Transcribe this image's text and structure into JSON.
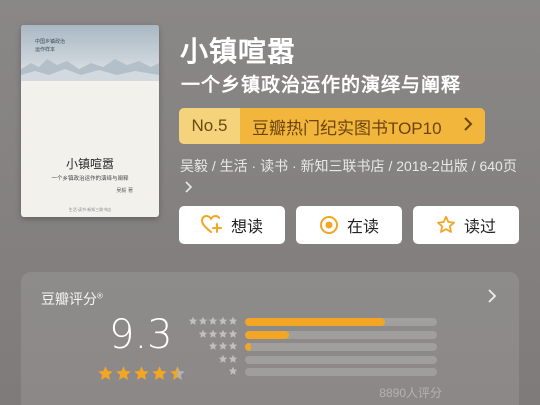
{
  "cover": {
    "series_line1": "中国乡镇政治",
    "series_line2": "运作样本",
    "title": "小镇喧嚣",
    "subtitle": "一个乡镇政治运作的演绎与阐释",
    "author": "吴毅 著",
    "publisher": "生活·读书·新知三联书店"
  },
  "book": {
    "title": "小镇喧嚣",
    "subtitle": "一个乡镇政治运作的演绎与阐释"
  },
  "rank": {
    "number": "No.5",
    "label": "豆瓣热门纪实图书TOP10"
  },
  "meta": {
    "line": "吴毅 / 生活 · 读书 · 新知三联书店 / 2018-2出版 / 640页"
  },
  "actions": [
    {
      "label": "想读",
      "icon": "heart-plus-icon"
    },
    {
      "label": "在读",
      "icon": "target-circle-icon"
    },
    {
      "label": "读过",
      "icon": "star-outline-icon"
    }
  ],
  "rating": {
    "label": "豆瓣评分",
    "label_mark": "®",
    "score": "9.3",
    "stars": 4.5,
    "distribution": [
      {
        "stars": 5,
        "fraction": 0.73
      },
      {
        "stars": 4,
        "fraction": 0.23
      },
      {
        "stars": 3,
        "fraction": 0.03
      },
      {
        "stars": 2,
        "fraction": 0.0
      },
      {
        "stars": 1,
        "fraction": 0.0
      }
    ],
    "count": "8890人评分"
  },
  "colors": {
    "accent": "#f3a623",
    "badge": "#f3b63c",
    "background": "#858281"
  }
}
